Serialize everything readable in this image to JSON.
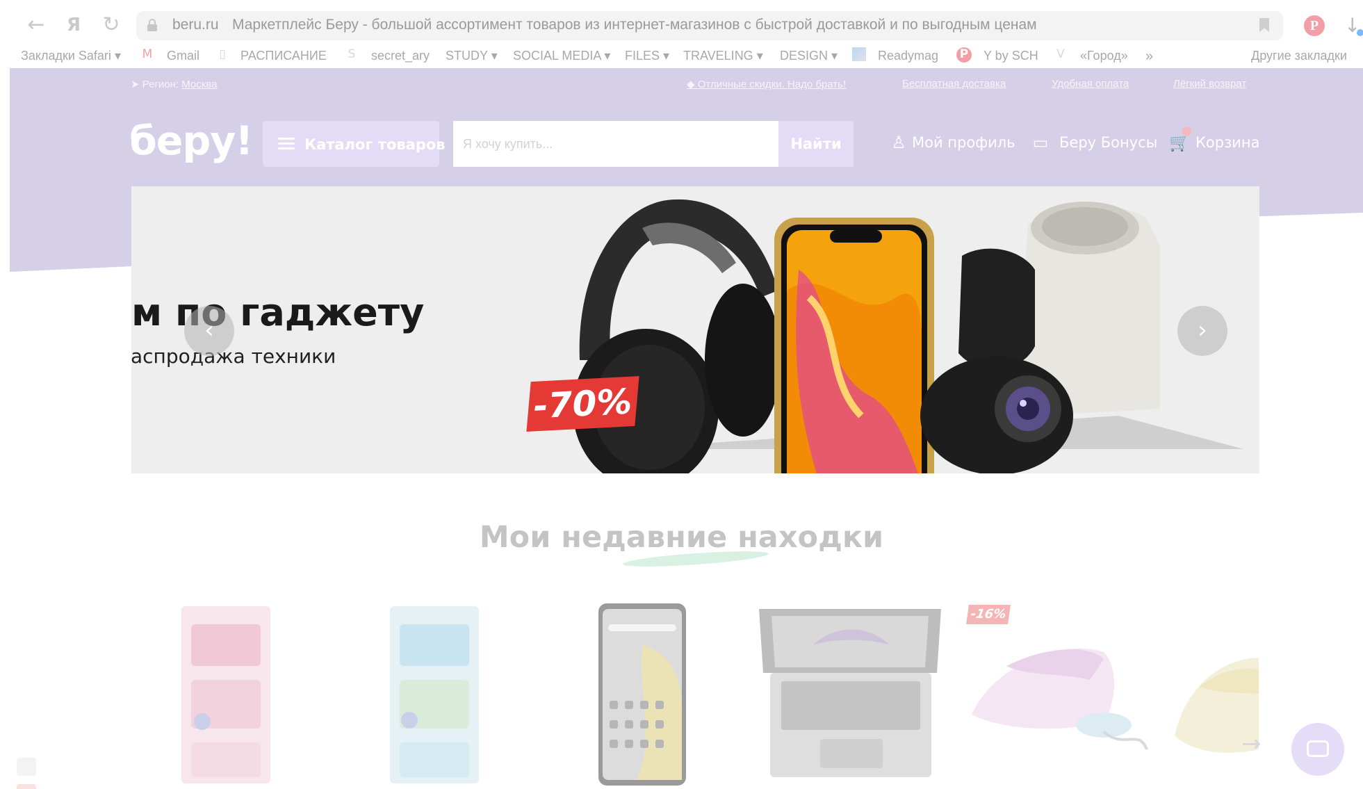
{
  "browser": {
    "url_domain": "beru.ru",
    "page_title": "Маркетплейс Беру - большой ассортимент товаров из интернет-магазинов с быстрой доставкой и по выгодным ценам",
    "bookmarks": [
      "Закладки Safari",
      "Gmail",
      "РАСПИСАНИЕ",
      "secret_ary",
      "STUDY",
      "SOCIAL MEDIA",
      "FILES",
      "TRAVELING",
      "DESIGN",
      "Readymag",
      "Y by SCH",
      "«Город»",
      "Другие закладки"
    ]
  },
  "topline": {
    "region_label": "Регион:",
    "region_value": "Москва",
    "promo": "Отличные скидки. Надо брать!",
    "delivery": "Бесплатная доставка",
    "payment": "Удобная оплата",
    "return": "Лёгкий возврат"
  },
  "header": {
    "logo": "беру!",
    "catalog_label": "Каталог товаров",
    "search_placeholder": "Я хочу купить...",
    "search_button": "Найти",
    "profile": "Мой профиль",
    "bonuses": "Беру Бонусы",
    "cart": "Корзина"
  },
  "banner": {
    "title": "м по гаджету",
    "subtitle": "аспродажа техники",
    "discount": "-70%"
  },
  "section": {
    "title": "Мои недавние находки",
    "discount_badge": "-16%"
  },
  "colors": {
    "header_bg": "#d5d0e8",
    "button_bg": "#e4dcf6",
    "discount_red": "#e53935"
  }
}
